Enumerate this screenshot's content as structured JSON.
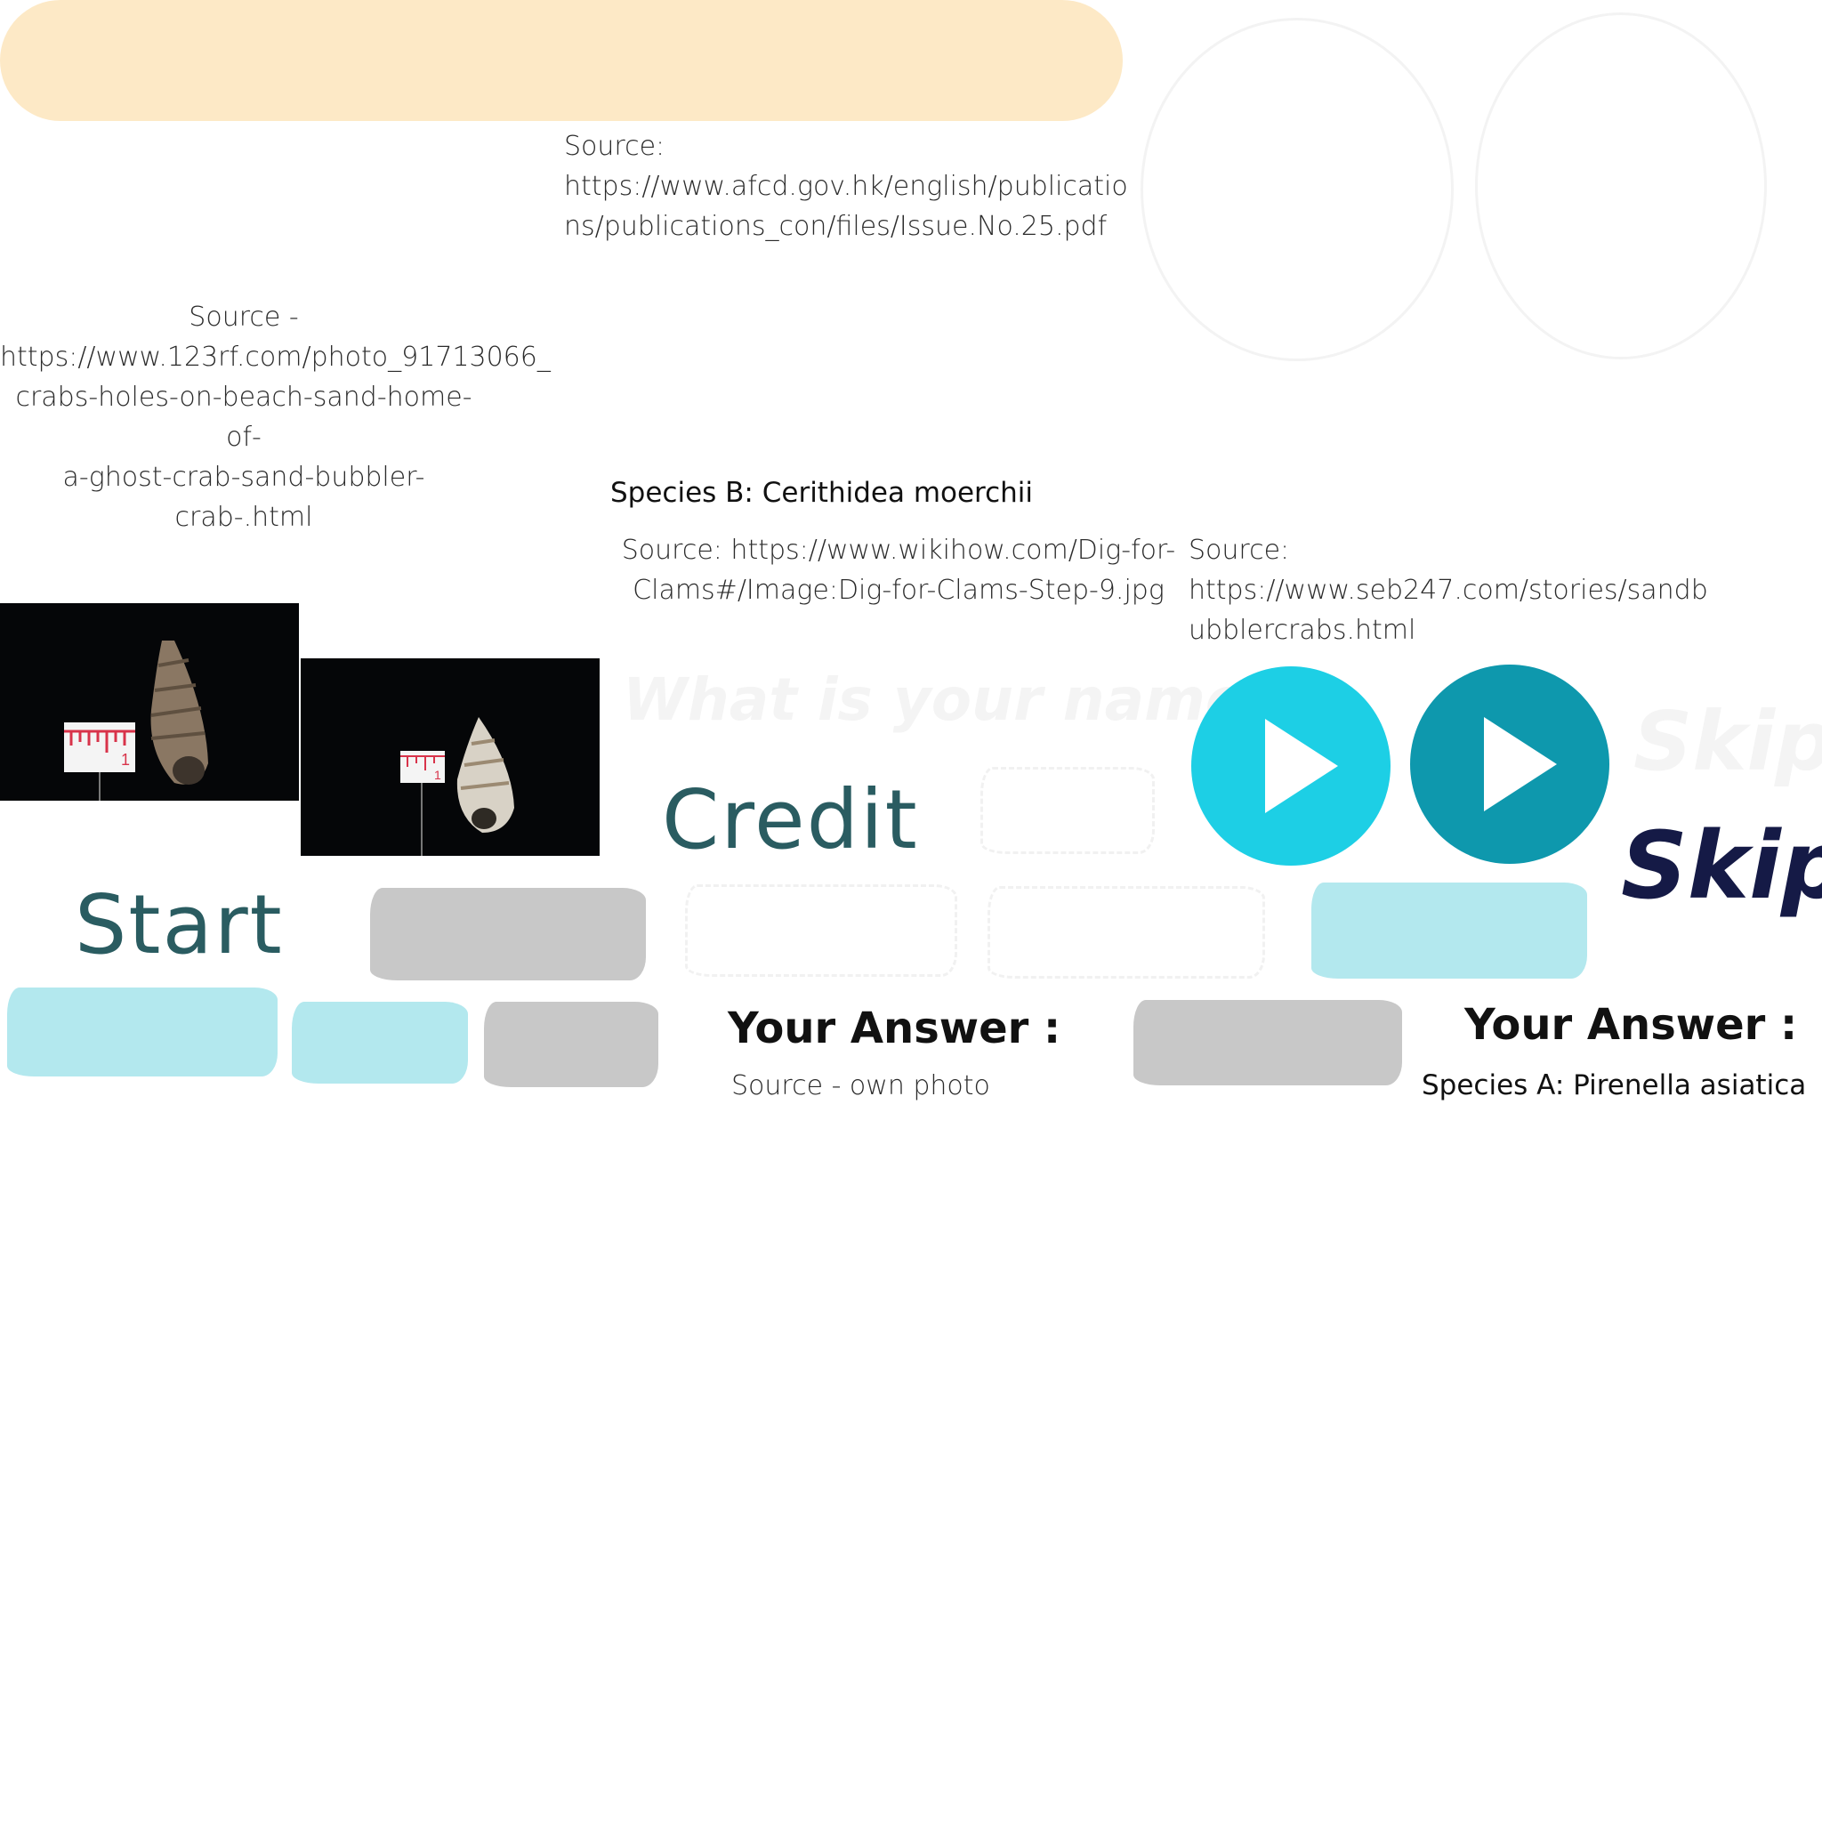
{
  "sources": {
    "afcd": "Source:\nhttps://www.afcd.gov.hk/english/publicatio\nns/publications_con/files/Issue.No.25.pdf",
    "rf123": "Source -\nhttps://www.123rf.com/photo_91713066_\ncrabs-holes-on-beach-sand-home-of-\na-ghost-crab-sand-bubbler-crab-.html",
    "wikihow": "Source: https://www.wikihow.com/Dig-for-\nClams#/Image:Dig-for-Clams-Step-9.jpg",
    "seb247": "Source:\nhttps://www.seb247.com/stories/sandb\nubblercrabs.html",
    "own": "Source - own photo"
  },
  "species": {
    "b": "Species B: Cerithidea moerchii",
    "a": "Species A: Pirenella asiatica"
  },
  "buttons": {
    "credit": "Credit",
    "start": "Start",
    "skip": "Skip",
    "skip_ghost": "Skip"
  },
  "answer_labels": {
    "left": "Your Answer :",
    "right": "Your Answer :"
  },
  "prompt": {
    "name_question": "What is your name?"
  },
  "colors": {
    "pill": "#fde9c6",
    "play_light": "#1dcfe5",
    "play_dark": "#0e98ad",
    "teal_text": "#2a5c61",
    "skip_navy": "#151a46",
    "swatch_cyan": "#b3e8ee",
    "swatch_grey": "#c8c8c8"
  },
  "icons": {
    "play_light": "play-icon",
    "play_dark": "play-icon"
  }
}
